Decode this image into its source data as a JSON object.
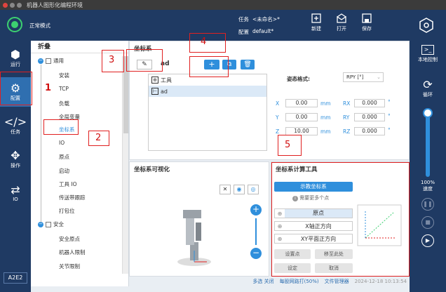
{
  "window_title": "机器人图形化编程环境",
  "header": {
    "mode": "正常模式",
    "task_label": "任务",
    "task_value": "<未命名>*",
    "config_label": "配置",
    "config_value": "default*",
    "btn_new": "新建",
    "btn_open": "打开",
    "btn_save": "保存"
  },
  "nav": {
    "run": "运行",
    "config": "配置",
    "task": "任务",
    "operate": "操作",
    "io": "IO",
    "version": "A2E2"
  },
  "right": {
    "local_control": "本地控制",
    "loop": "循环",
    "speed_value": "100%",
    "speed_label": "速度"
  },
  "tree": {
    "header": "折叠",
    "general": "通用",
    "items": [
      "安装",
      "TCP",
      "负载",
      "全局变量",
      "坐标系",
      "IO",
      "原点",
      "启动",
      "工具 IO",
      "传送带跟踪",
      "打包位"
    ],
    "safety": "安全",
    "safety_items": [
      "安全原点",
      "机器人限制",
      "关节限制"
    ]
  },
  "frame": {
    "title": "坐标系",
    "current": "ad",
    "list": [
      "工具",
      "ad"
    ],
    "pose_format_label": "姿态格式:",
    "pose_format_value": "RPY [°]",
    "x_label": "X",
    "x_value": "0.00",
    "x_unit": "mm",
    "y_label": "Y",
    "y_value": "0.00",
    "y_unit": "mm",
    "z_label": "Z",
    "z_value": "10.00",
    "z_unit": "mm",
    "rx_label": "RX",
    "rx_value": "0.000",
    "rx_unit": "°",
    "ry_label": "RY",
    "ry_value": "0.000",
    "ry_unit": "°",
    "rz_label": "RZ",
    "rz_value": "0.000",
    "rz_unit": "°"
  },
  "viz": {
    "title": "坐标系可视化"
  },
  "calc": {
    "title": "坐标系计算工具",
    "teach_btn": "示教坐标系",
    "hint": "需要更多个点",
    "origin": "原点",
    "x_dir": "X轴正方向",
    "xy_plane": "XY平面正方向",
    "set_point": "设置点",
    "move_here": "移至此处",
    "set": "设定",
    "cancel": "取消"
  },
  "status": {
    "multi": "多选 关闭",
    "info": "每股网路打(50%)",
    "file_mgr": "文件管理器",
    "datetime": "2024-12-18 10:13:54"
  },
  "annotations": [
    "1",
    "2",
    "3",
    "4",
    "5"
  ],
  "colors": {
    "nav_bg": "#1f3a63",
    "active": "#2f6fb0",
    "accent": "#2f8fdc",
    "mark": "#e02020"
  }
}
